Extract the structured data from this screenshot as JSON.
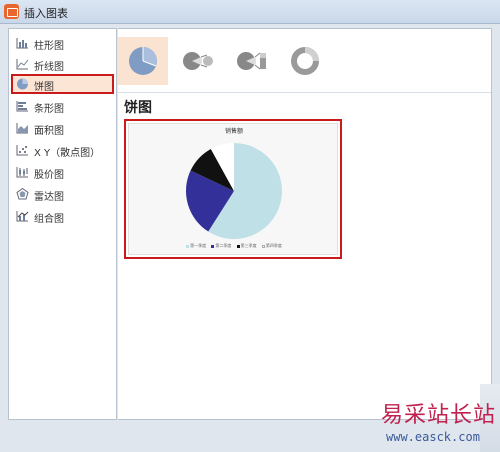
{
  "window": {
    "title": "插入图表"
  },
  "sidebar": {
    "items": [
      {
        "label": "柱形图",
        "icon": "column-chart-icon"
      },
      {
        "label": "折线图",
        "icon": "line-chart-icon"
      },
      {
        "label": "饼图",
        "icon": "pie-chart-icon",
        "selected": true
      },
      {
        "label": "条形图",
        "icon": "bar-chart-icon"
      },
      {
        "label": "面积图",
        "icon": "area-chart-icon"
      },
      {
        "label": "X Y（散点图）",
        "icon": "scatter-chart-icon"
      },
      {
        "label": "股价图",
        "icon": "stock-chart-icon"
      },
      {
        "label": "雷达图",
        "icon": "radar-chart-icon"
      },
      {
        "label": "组合图",
        "icon": "combo-chart-icon"
      }
    ]
  },
  "subtypes": [
    {
      "icon": "pie-icon",
      "selected": true
    },
    {
      "icon": "pie-of-pie-icon"
    },
    {
      "icon": "bar-of-pie-icon"
    },
    {
      "icon": "doughnut-icon"
    }
  ],
  "section": {
    "title": "饼图"
  },
  "preview": {
    "chart_data": {
      "type": "pie",
      "title": "销售额",
      "categories": [
        "第一季度",
        "第二季度",
        "第三季度",
        "第四季度"
      ],
      "values": [
        59,
        23,
        10,
        8
      ],
      "colors": [
        "#bfe0e6",
        "#33309a",
        "#111111",
        "#ffffff"
      ]
    }
  },
  "watermark": {
    "text": "易采站长站",
    "url": "www.easck.com"
  },
  "colors": {
    "accent": "#c91b1b",
    "selected_bg": "#fde5d5"
  }
}
